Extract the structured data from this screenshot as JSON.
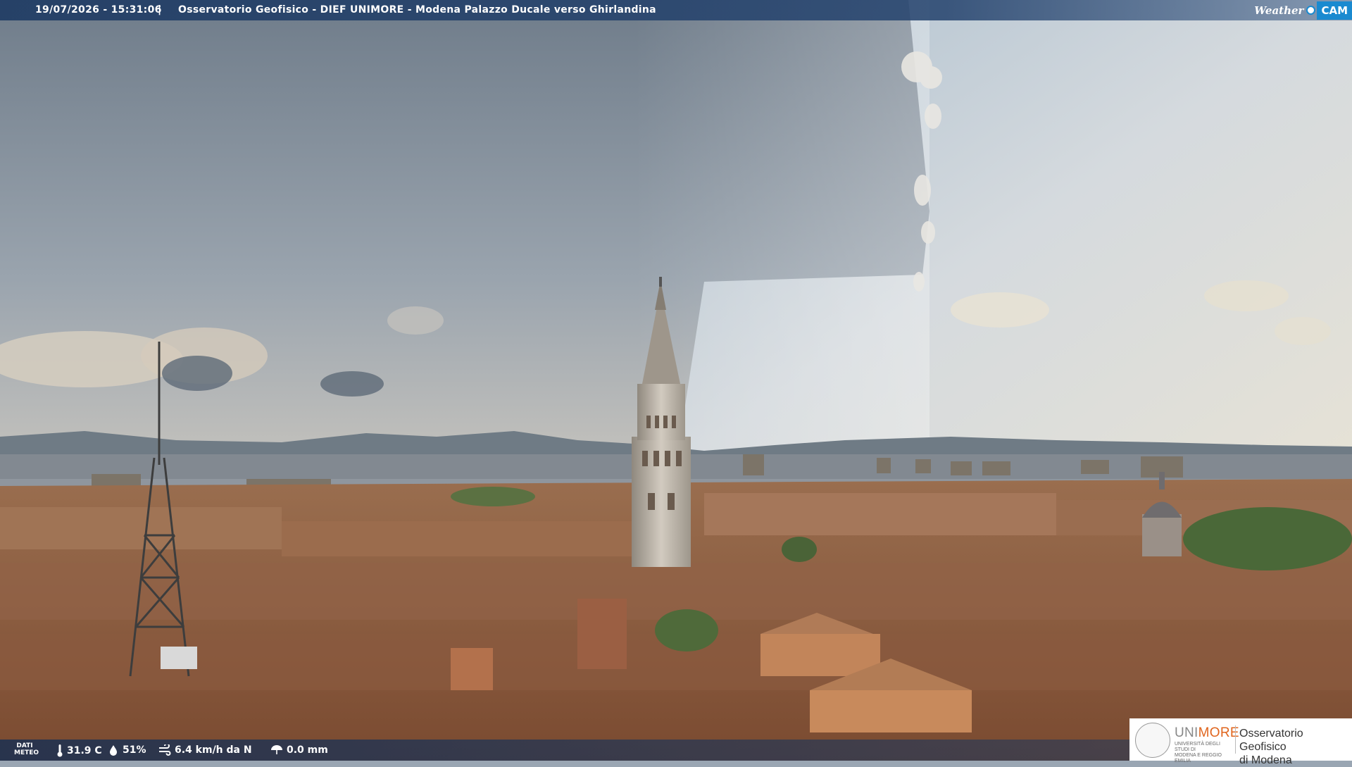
{
  "overlay": {
    "timestamp": "19/07/2026 - 15:31:06",
    "separator": "|",
    "caption": "Osservatorio Geofisico - DIEF UNIMORE - Modena Palazzo Ducale verso Ghirlandina",
    "brand_weather": "Weather",
    "brand_cam": "CAM"
  },
  "meteo": {
    "label_line1": "DATI",
    "label_line2": "METEO",
    "temperature": "31.9 C",
    "humidity": "51%",
    "wind": "6.4 km/h da N",
    "rain": "0.0 mm"
  },
  "logo": {
    "uni_part1": "UNI",
    "uni_part2": "MORE",
    "small_line1": "UNIVERSITÀ DEGLI STUDI DI",
    "small_line2": "MODENA E REGGIO EMILIA",
    "org_line1": "Osservatorio Geofisico",
    "org_line2": "di Modena"
  },
  "colors": {
    "bar": "#2a4a78",
    "accent": "#1a8ad0",
    "unimore_orange": "#e0651e"
  }
}
